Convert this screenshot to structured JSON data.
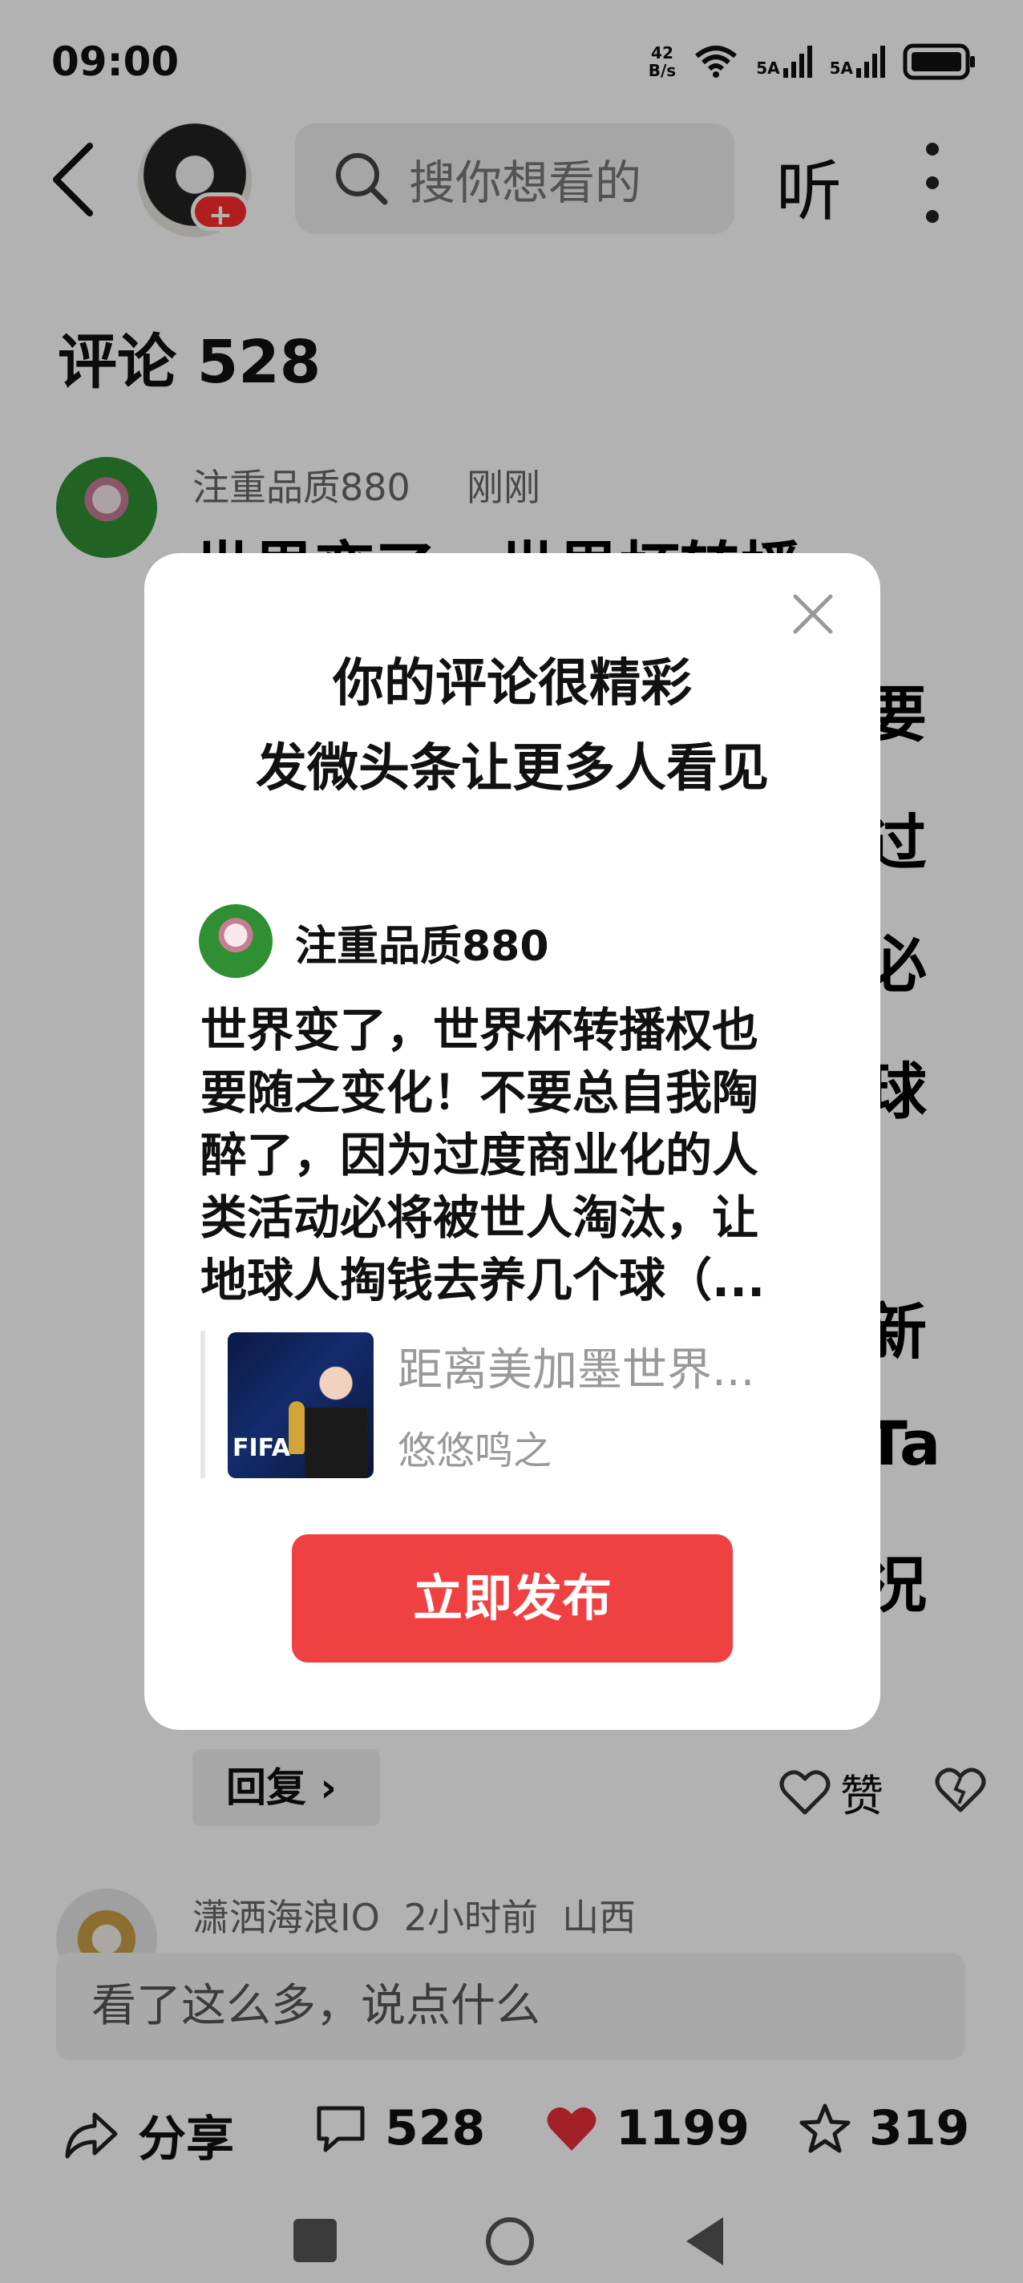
{
  "status_bar": {
    "time": "09:00",
    "net_speed_value": "42",
    "net_speed_unit": "B/s",
    "signal_1": "5A",
    "signal_2": "5A"
  },
  "header": {
    "search_placeholder": "搜你想看的",
    "listen_label": "听",
    "avatar_badge": "+"
  },
  "comments_title": "评论 528",
  "comment": {
    "user": "注重品质880",
    "time": "刚刚",
    "visible_fragments": [
      "世界变了，世界杯转播",
      "要",
      "过",
      "必",
      "球",
      "新",
      "Ta",
      "况"
    ]
  },
  "comment_actions": {
    "reply_label": "回复",
    "like_label": "赞"
  },
  "next_comment": {
    "user": "潇洒海浪IO",
    "time": "2小时前",
    "location": "山西"
  },
  "input_placeholder": "看了这么多，说点什么",
  "action_bar": {
    "share_label": "分享",
    "comments_count": "528",
    "likes_count": "1199",
    "favorites_count": "319"
  },
  "modal": {
    "title_line1": "你的评论很精彩",
    "title_line2": "发微头条让更多人看见",
    "user": "注重品质880",
    "text_lines": [
      "世界变了，世界杯转播权也",
      "要随之变化！不要总自我陶",
      "醉了，因为过度商业化的人",
      "类活动必将被世人淘汰，让",
      "地球人掏钱去养几个球（..."
    ],
    "quote_title": "距离美加墨世界...",
    "quote_author": "悠悠鸣之",
    "quote_thumb_text": "FIFA",
    "publish_label": "立即发布"
  },
  "colors": {
    "accent_red": "#f04142",
    "like_red": "#e8303a",
    "badge_red": "#ff2b2b"
  }
}
